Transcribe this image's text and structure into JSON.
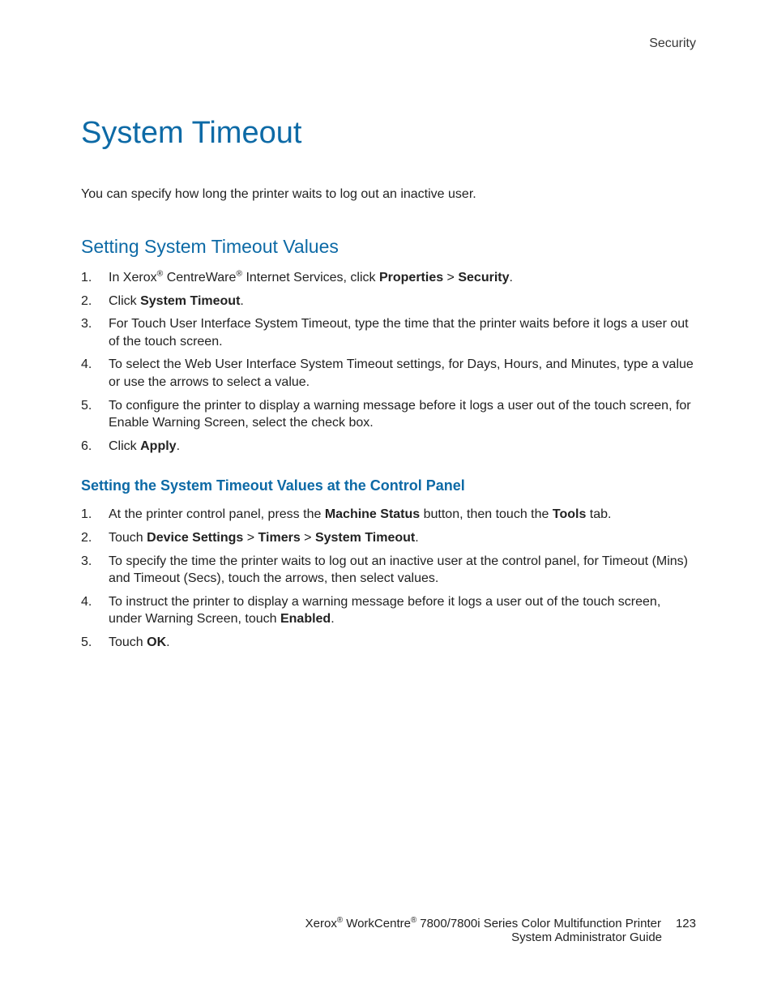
{
  "header": {
    "label": "Security"
  },
  "title": "System Timeout",
  "intro": "You can specify how long the printer waits to log out an inactive user.",
  "section1": {
    "heading": "Setting System Timeout Values",
    "steps": [
      {
        "n": "1.",
        "pre": "In Xerox",
        "sup1": "®",
        "mid1": " CentreWare",
        "sup2": "®",
        "mid2": " Internet Services, click ",
        "b1": "Properties",
        "sep": " > ",
        "b2": "Security",
        "post": "."
      },
      {
        "n": "2.",
        "pre": "Click ",
        "b1": "System Timeout",
        "post": "."
      },
      {
        "n": "3.",
        "text": "For Touch User Interface System Timeout, type the time that the printer waits before it logs a user out of the touch screen."
      },
      {
        "n": "4.",
        "text": "To select the Web User Interface System Timeout settings, for Days, Hours, and Minutes, type a value or use the arrows to select a value."
      },
      {
        "n": "5.",
        "text": "To configure the printer to display a warning message before it logs a user out of the touch screen, for Enable Warning Screen, select the check box."
      },
      {
        "n": "6.",
        "pre": "Click ",
        "b1": "Apply",
        "post": "."
      }
    ]
  },
  "section2": {
    "heading": "Setting the System Timeout Values at the Control Panel",
    "steps": [
      {
        "n": "1.",
        "pre": "At the printer control panel, press the ",
        "b1": "Machine Status",
        "mid": " button, then touch the ",
        "b2": "Tools",
        "post": " tab."
      },
      {
        "n": "2.",
        "pre": "Touch ",
        "b1": "Device Settings",
        "sep1": " > ",
        "b2": "Timers",
        "sep2": " > ",
        "b3": "System Timeout",
        "post": "."
      },
      {
        "n": "3.",
        "text": "To specify the time the printer waits to log out an inactive user at the control panel, for Timeout (Mins) and Timeout (Secs), touch the arrows, then select values."
      },
      {
        "n": "4.",
        "pre": "To instruct the printer to display a warning message before it logs a user out of the touch screen, under Warning Screen, touch ",
        "b1": "Enabled",
        "post": "."
      },
      {
        "n": "5.",
        "pre": "Touch ",
        "b1": "OK",
        "post": "."
      }
    ]
  },
  "footer": {
    "brand1": "Xerox",
    "sup1": "®",
    "brand2": " WorkCentre",
    "sup2": "®",
    "line1_rest": " 7800/7800i Series Color Multifunction Printer",
    "page": "123",
    "line2": "System Administrator Guide"
  }
}
